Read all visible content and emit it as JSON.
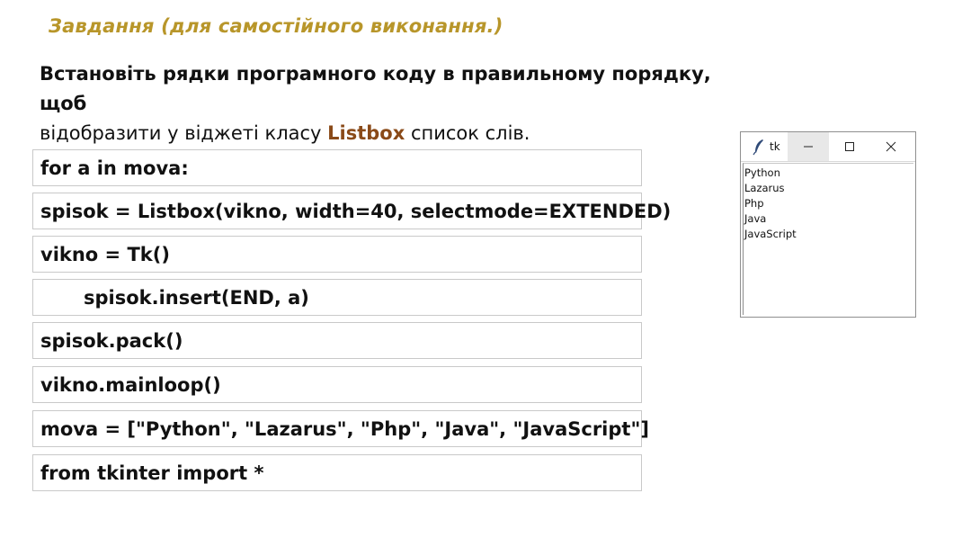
{
  "task_title": "Завдання (для самостійного виконання.)",
  "instruction": {
    "bold_part": "Встановіть рядки програмного коду в правильному порядку, щоб",
    "part2": "відобразити у віджеті класу ",
    "keyword": "Listbox",
    "part3": " список слів."
  },
  "code_lines": [
    {
      "text": "for a in mova:"
    },
    {
      "text": "spisok = Listbox(vikno, width=40, selectmode=EXTENDED)"
    },
    {
      "text": "vikno = Tk()"
    },
    {
      "text": "spisok.insert(END, a)"
    },
    {
      "text": "spisok.pack()"
    },
    {
      "text": "vikno.mainloop()"
    },
    {
      "text": "mova = [\"Python\", \"Lazarus\", \"Php\", \"Java\", \"JavaScript\"]"
    },
    {
      "text": "from tkinter import *"
    }
  ],
  "tk_window": {
    "title": "tk",
    "icons": [
      "feather-icon",
      "minimize-icon",
      "maximize-icon",
      "close-icon"
    ],
    "items": [
      "Python",
      "Lazarus",
      "Php",
      "Java",
      "JavaScript"
    ]
  },
  "colors": {
    "title": "#b8962a",
    "keyword": "#8a4a18"
  }
}
